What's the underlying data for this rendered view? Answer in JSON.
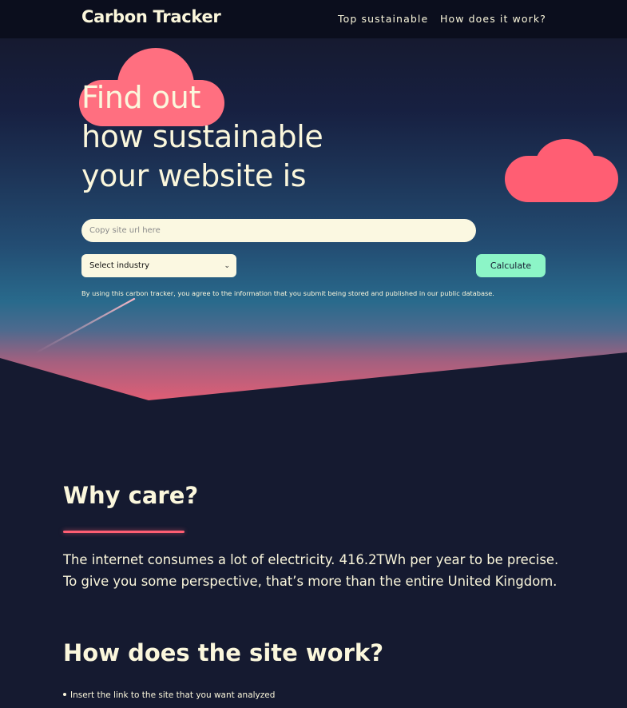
{
  "header": {
    "brand": "Carbon Tracker",
    "nav": [
      {
        "label": "Top sustainable"
      },
      {
        "label": "How does it work?"
      }
    ]
  },
  "hero": {
    "headline": [
      "Find out",
      "how sustainable",
      "your website is"
    ],
    "url_input": {
      "placeholder": "Copy site url here",
      "value": ""
    },
    "industry_select": {
      "selected": "Select industry"
    },
    "calculate_label": "Calculate",
    "consent": "By using this carbon tracker, you agree to the information that you submit being stored and published in our public database."
  },
  "why": {
    "heading": "Why care?",
    "lines": [
      "The internet consumes a lot of electricity. 416.2TWh per year to be precise.",
      "To give you some perspective, that’s more than the entire United Kingdom."
    ]
  },
  "how": {
    "heading": "How does the site work?",
    "steps": [
      "Insert the link to the site that you want analyzed"
    ]
  },
  "colors": {
    "background": "#151a30",
    "header_bg": "#0b0e1d",
    "text_cream": "#fbf7dc",
    "cloud_pink": "#ff5e73",
    "calculate_green": "#8cf5c7",
    "input_bg": "#fbf8e1"
  },
  "icons": {
    "select_chevron": "chevron-down-icon",
    "decorations": [
      "cloud-icon",
      "cloud-icon",
      "shooting-star-icon"
    ]
  }
}
